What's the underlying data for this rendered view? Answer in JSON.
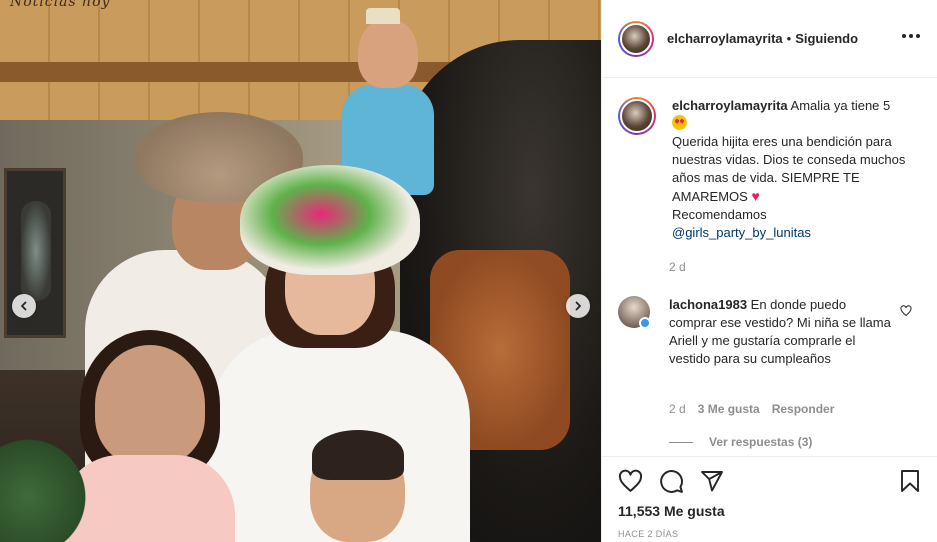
{
  "photo": {
    "watermark": "Noticias hoy",
    "prev_icon": "chevron-left-icon",
    "next_icon": "chevron-right-icon"
  },
  "header": {
    "username": "elcharroylamayrita",
    "separator": "•",
    "follow_status": "Siguiendo",
    "more_icon": "more-horizontal-icon"
  },
  "caption": {
    "username": "elcharroylamayrita",
    "line1": "Amalia ya tiene 5",
    "body": "Querida hijita eres una bendición para nuestras vidas. Dios te conseda muchos años mas de vida. SIEMPRE TE AMAREMOS",
    "recommend": "Recomendamos",
    "mention": "@girls_party_by_lunitas",
    "time": "2 d"
  },
  "comment": {
    "username": "lachona1983",
    "text": "En donde puedo comprar ese vestido? Mi niña se llama Ariell y me gustaría comprarle el vestido para su cumpleaños",
    "time": "2 d",
    "likes": "3 Me gusta",
    "reply": "Responder",
    "view_replies": "Ver respuestas (3)"
  },
  "actions": {
    "like_icon": "heart-icon",
    "comment_icon": "comment-icon",
    "share_icon": "send-icon",
    "save_icon": "bookmark-icon",
    "likes_count": "11,553 Me gusta",
    "posted": "HACE 2 DÍAS"
  },
  "colors": {
    "text": "#262626",
    "muted": "#8e8e8e",
    "link": "#00376b",
    "heart": "#e0245e"
  }
}
